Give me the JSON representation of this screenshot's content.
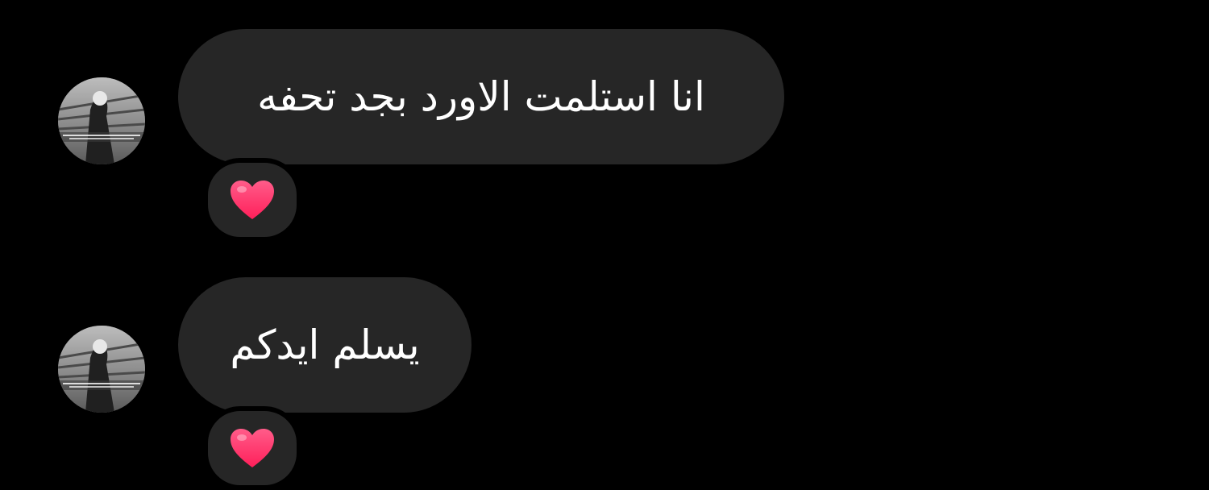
{
  "messages": [
    {
      "text": "انا استلمت الاورد بجد تحفه",
      "reaction": "red-heart-icon",
      "avatar": "profile-avatar"
    },
    {
      "text": "يسلم ايدكم",
      "reaction": "red-heart-icon",
      "avatar": "profile-avatar"
    }
  ],
  "colors": {
    "background": "#000000",
    "bubble": "#262626",
    "text": "#ffffff",
    "heart": "#ff2d6a"
  }
}
